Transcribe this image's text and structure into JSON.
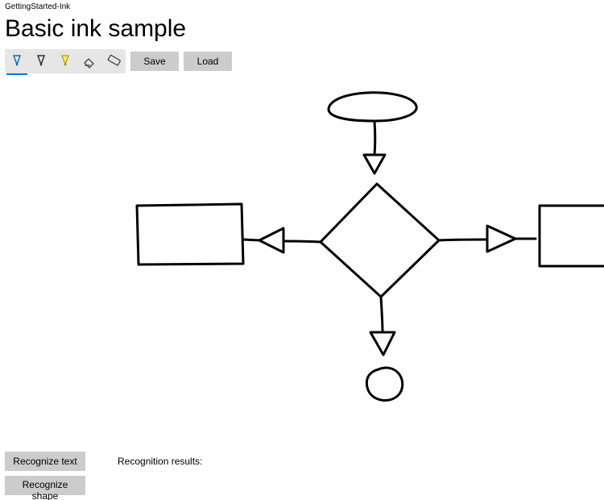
{
  "window": {
    "title": "GettingStarted-Ink"
  },
  "header": {
    "title": "Basic ink sample"
  },
  "toolbar": {
    "pens": [
      {
        "name": "ballpoint-pen",
        "color": "#0f6cbd",
        "selected": true
      },
      {
        "name": "pencil",
        "color": "#333333",
        "selected": false
      },
      {
        "name": "highlighter",
        "color": "#e8d700",
        "selected": false
      },
      {
        "name": "eraser",
        "color": "#444444",
        "selected": false
      },
      {
        "name": "ruler",
        "color": "#444444",
        "selected": false
      }
    ],
    "save_label": "Save",
    "load_label": "Load"
  },
  "recognition": {
    "text_button": "Recognize text",
    "shape_button": "Recognize shape",
    "results_label": "Recognition results:"
  }
}
